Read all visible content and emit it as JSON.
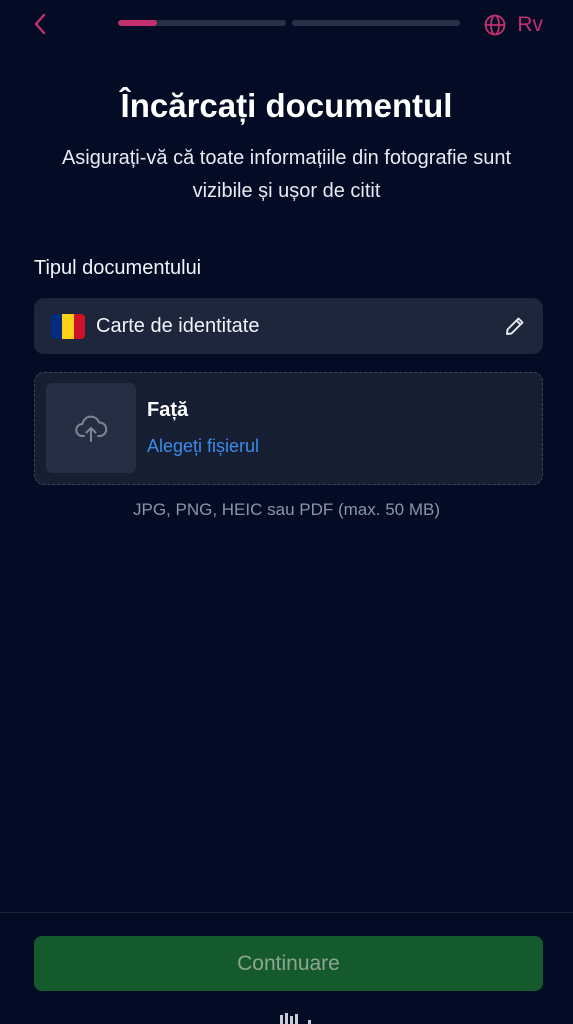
{
  "header": {
    "back_icon": "chevron-left-icon",
    "progress": {
      "steps": 2,
      "current_step_fraction": 0.23
    },
    "language_icon": "globe-icon",
    "language_label": "Rv"
  },
  "page": {
    "title": "Încărcați documentul",
    "subtitle": "Asigurați-vă că toate informațiile din fotografie sunt vizibile și ușor de citit"
  },
  "document_type": {
    "label": "Tipul documentului",
    "value": "Carte de identitate",
    "flag": "romania-flag",
    "flag_colors": [
      "#002b7f",
      "#fcd116",
      "#ce1126"
    ],
    "edit_icon": "pencil-icon"
  },
  "upload": {
    "side_label": "Față",
    "choose_file_label": "Alegeți fișierul",
    "icon": "cloud-upload-icon",
    "formats_hint": "JPG, PNG, HEIC sau PDF (max. 50 MB)"
  },
  "footer": {
    "continue_label": "Continuare"
  },
  "colors": {
    "background": "#030c24",
    "accent": "#c2306d",
    "link": "#3b8bea",
    "primary_button": "#155a2c"
  }
}
